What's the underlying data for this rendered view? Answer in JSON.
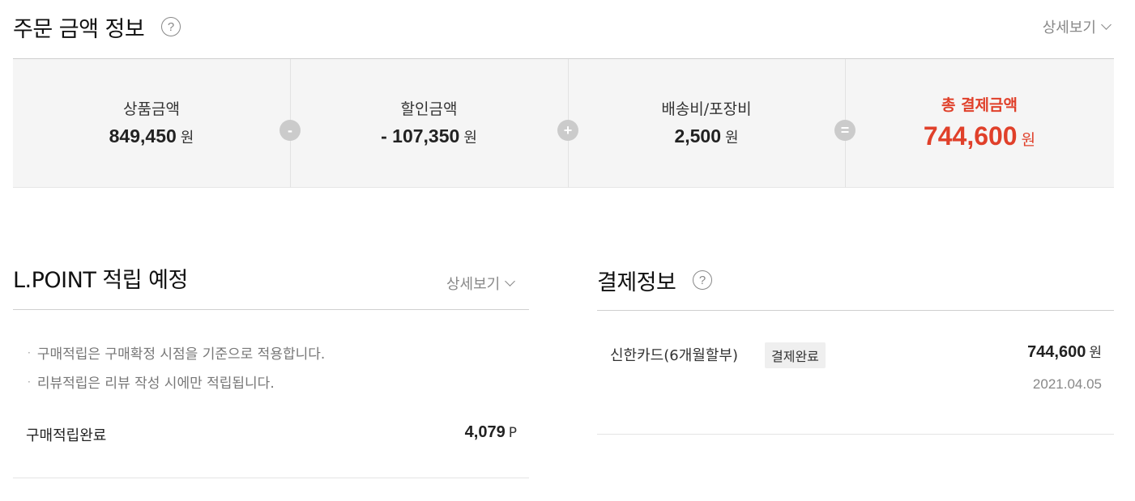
{
  "order_amount": {
    "title": "주문 금액 정보",
    "help_icon": "question-circle-icon",
    "detail_link": "상세보기",
    "items": [
      {
        "label": "상품금액",
        "value": "849,450",
        "unit": "원"
      },
      {
        "label": "할인금액",
        "value": "- 107,350",
        "unit": "원"
      },
      {
        "label": "배송비/포장비",
        "value": "2,500",
        "unit": "원"
      },
      {
        "label": "총 결제금액",
        "value": "744,600",
        "unit": "원"
      }
    ],
    "operators": [
      "-",
      "+",
      "="
    ],
    "accent_color": "#e0402a"
  },
  "lpoint": {
    "title": "L.POINT 적립 예정",
    "detail_link": "상세보기",
    "notes": [
      "구매적립은 구매확정 시점을 기준으로 적용합니다.",
      "리뷰적립은 리뷰 작성 시에만 적립됩니다."
    ],
    "bullet": "·",
    "row": {
      "label": "구매적립완료",
      "value": "4,079",
      "unit": "P"
    }
  },
  "payment": {
    "title": "결제정보",
    "help_icon": "question-circle-icon",
    "method": "신한카드(6개월할부)",
    "status_badge": "결제완료",
    "amount": "744,600",
    "unit": "원",
    "date": "2021.04.05"
  }
}
